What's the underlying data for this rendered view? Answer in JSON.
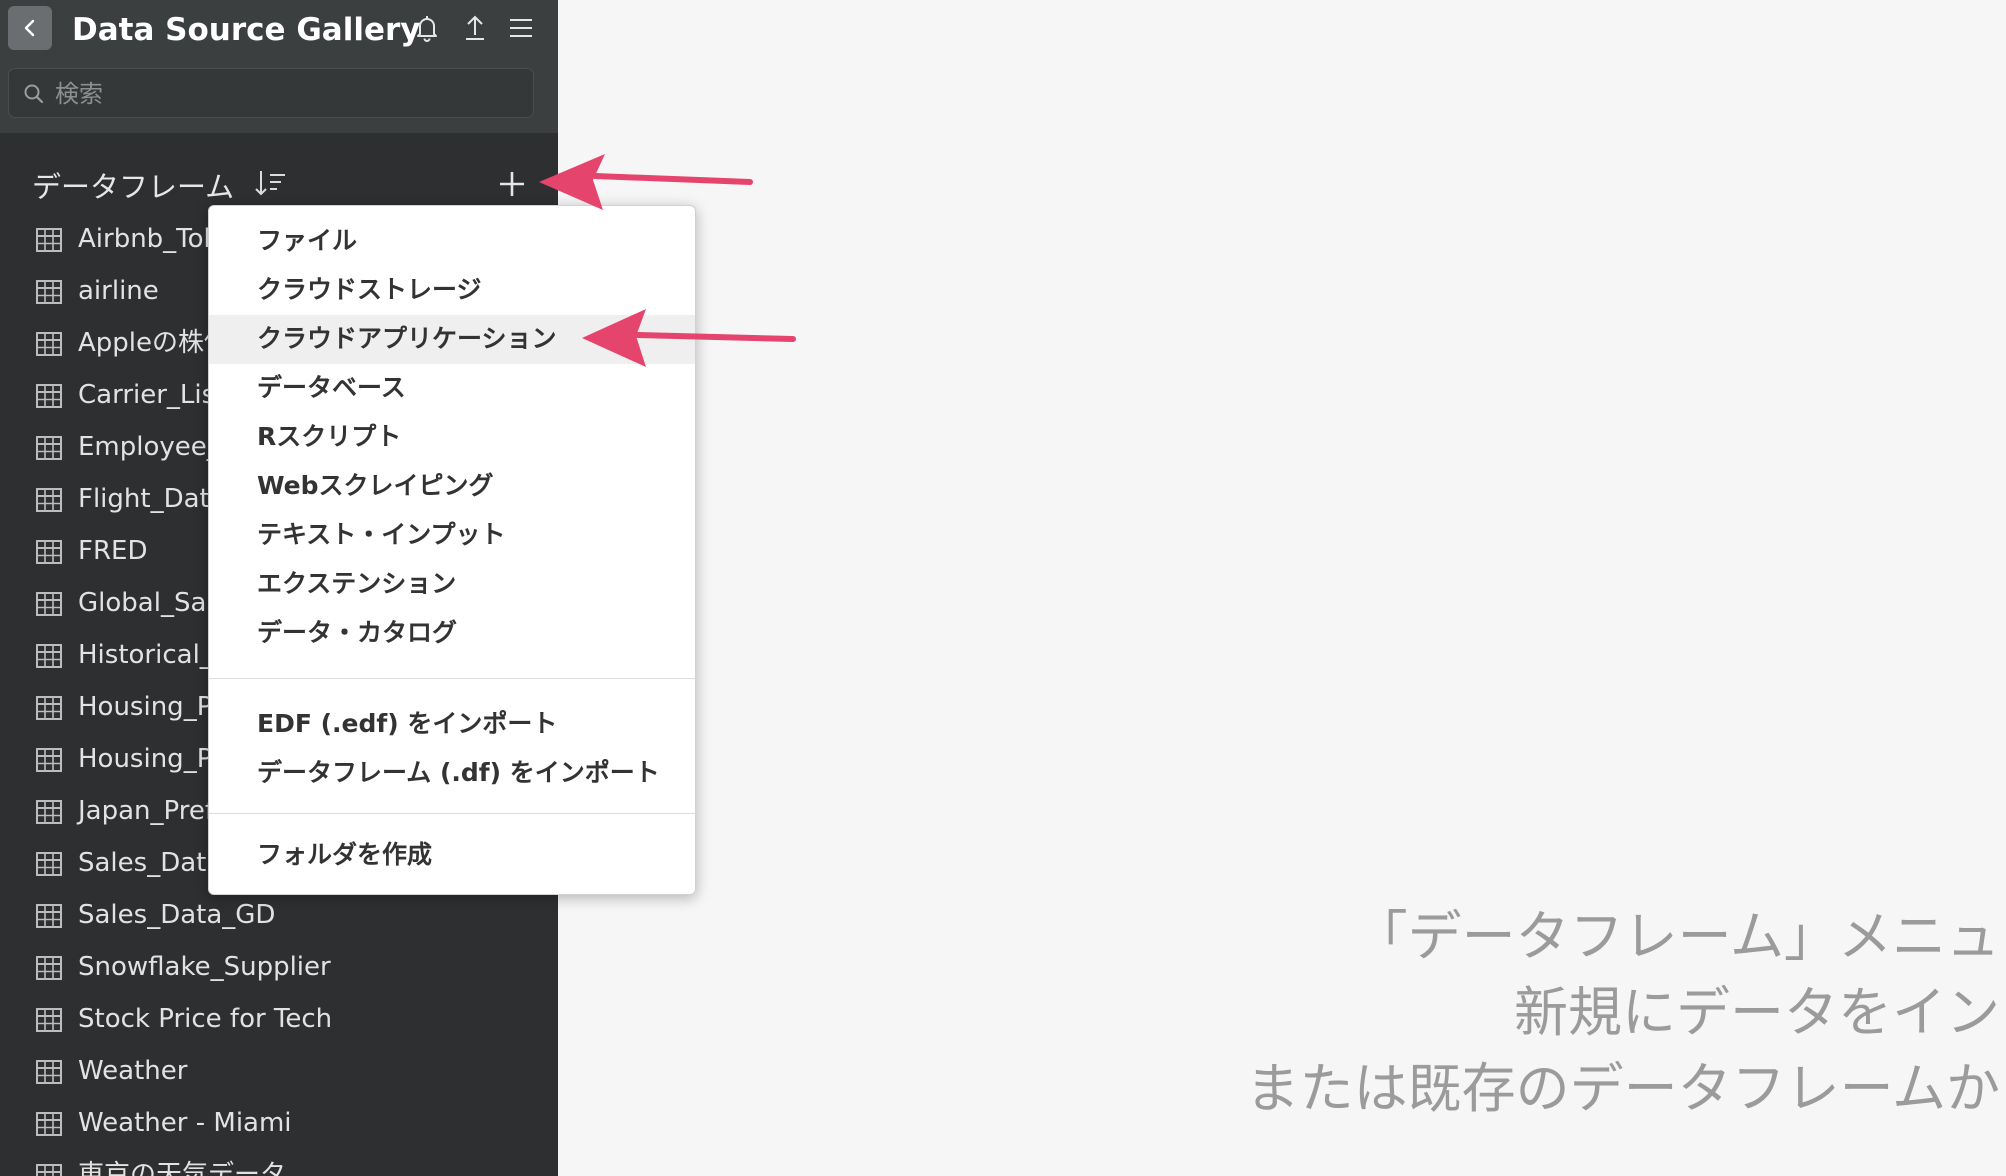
{
  "app": {
    "title": "Data Source Gallery"
  },
  "header_icons": [
    "back-icon",
    "bell-icon",
    "upload-icon",
    "hamburger-menu-icon"
  ],
  "search": {
    "placeholder": "検索",
    "value": ""
  },
  "sidebar": {
    "section_title": "データフレーム",
    "items": [
      {
        "label": "Airbnb_Tok"
      },
      {
        "label": "airline"
      },
      {
        "label": "Appleの株価"
      },
      {
        "label": "Carrier_List"
      },
      {
        "label": "Employee_"
      },
      {
        "label": "Flight_Data"
      },
      {
        "label": "FRED"
      },
      {
        "label": "Global_Sale"
      },
      {
        "label": "Historical_S"
      },
      {
        "label": "Housing_Pr"
      },
      {
        "label": "Housing_Pr"
      },
      {
        "label": "Japan_Pref"
      },
      {
        "label": "Sales_Data"
      },
      {
        "label": "Sales_Data_GD"
      },
      {
        "label": "Snowflake_Supplier"
      },
      {
        "label": "Stock Price for Tech"
      },
      {
        "label": "Weather"
      },
      {
        "label": "Weather - Miami"
      },
      {
        "label": "東京の天気データ"
      }
    ]
  },
  "menu": {
    "group1": [
      "ファイル",
      "クラウドストレージ",
      "クラウドアプリケーション",
      "データベース",
      "Rスクリプト",
      "Webスクレイピング",
      "テキスト・インプット",
      "エクステンション",
      "データ・カタログ"
    ],
    "group2": [
      "EDF (.edf) をインポート",
      "データフレーム (.df) をインポート"
    ],
    "group3": [
      "フォルダを作成"
    ],
    "highlighted": "クラウドアプリケーション"
  },
  "main": {
    "lines": [
      "「データフレーム」メニュ",
      "新規にデータをイン",
      "または既存のデータフレームか"
    ]
  },
  "colors": {
    "sidebar_bg": "#2d2f30",
    "topbar_bg": "#3c3f40",
    "arrow": "#e5456d",
    "menu_highlight": "#efefef"
  }
}
